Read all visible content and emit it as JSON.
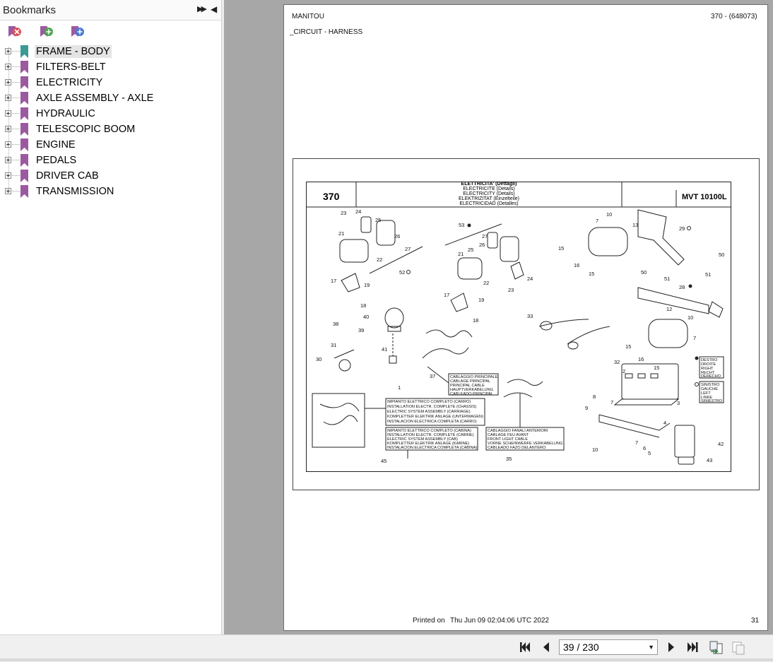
{
  "sidebar": {
    "title": "Bookmarks",
    "toolbar": {
      "delete_icon": "delete-bookmark-icon",
      "add_icon": "add-bookmark-icon",
      "add_child_icon": "add-child-bookmark-icon"
    },
    "items": [
      {
        "label": "FRAME - BODY",
        "selected": true
      },
      {
        "label": "FILTERS-BELT"
      },
      {
        "label": "ELECTRICITY"
      },
      {
        "label": "AXLE ASSEMBLY - AXLE"
      },
      {
        "label": "HYDRAULIC"
      },
      {
        "label": "TELESCOPIC BOOM"
      },
      {
        "label": "ENGINE"
      },
      {
        "label": "PEDALS"
      },
      {
        "label": "DRIVER CAB"
      },
      {
        "label": "TRANSMISSION"
      }
    ]
  },
  "document": {
    "brand": "MANITOU",
    "ref": "370 - (648073)",
    "section": "_CIRCUIT - HARNESS",
    "printed_label": "Printed on",
    "printed_date": "Thu Jun 09 02:04:06 UTC 2022",
    "page_number": "31",
    "figure": {
      "code": "370",
      "model": "MVT 10100L",
      "titles": [
        "ELETTRICITA' (Dettagli)",
        "ELECTRICITE (Details)",
        "ELECTRICITY (Details)",
        "ELEKTRIZITAT (Einzelteile)",
        "ELECTRICIDAD (Detalles)"
      ],
      "callouts": {
        "c37": [
          "CABLAGGIO PRINCIPALE",
          "CABLAGE PRINCIPAL",
          "PRINCIPAL CABLE",
          "HAUPTVERKABELUNG",
          "CABLEADO PRINCIPAL"
        ],
        "c1": [
          "IMPIANTO ELETTRICO COMPLETO (CARRO)",
          "INSTALLATION ELECTR. COMPLETE (CHASSIS)",
          "ELECTRIC SYSTEM ASSEMBLY (CARRIAGE)",
          "KOMPLETTER ELEKTRIK ANLAGE (UNTERWAGEN)",
          "INSTALACION ELECTRICA COMPLETA (CARRO)"
        ],
        "c45": [
          "IMPIANTO ELETTRICO COMPLETO (CABINA)",
          "INSTALLATION ELECTR. COMPLETE (CABINE)",
          "ELECTRIC SYSTEM ASSEMBLY (CAB)",
          "KOMPLETTER ELEKTRIK ANLAGE (KABINE)",
          "INSTALACION ELECTRICA COMPLETA (CABINA)"
        ],
        "c35": [
          "CABLAGGIO FANALI ANTERIORI",
          "CABLAGE FEU AVANT",
          "FRONT LIGHT CABLE",
          "VORNE SCHEINWERFE VERKABELUNG",
          "CABLEADO FAZO DELANTERO"
        ],
        "right": [
          "DESTRO",
          "DROITE",
          "RIGHT",
          "RECHT",
          "DERECHO"
        ],
        "left": [
          "SINISTRO",
          "GAUCHE",
          "LEFT",
          "LINKE",
          "SINIESTRO"
        ]
      },
      "numbers": [
        "23",
        "24",
        "25",
        "21",
        "26",
        "27",
        "22",
        "52",
        "17",
        "19",
        "18",
        "40",
        "38",
        "39",
        "31",
        "41",
        "30",
        "53",
        "27",
        "26",
        "25",
        "21",
        "22",
        "23",
        "24",
        "17",
        "19",
        "18",
        "33",
        "37",
        "1",
        "45",
        "35",
        "10",
        "7",
        "13",
        "15",
        "16",
        "15",
        "29",
        "50",
        "51",
        "50",
        "51",
        "28",
        "12",
        "10",
        "7",
        "15",
        "16",
        "15",
        "32",
        "2",
        "8",
        "7",
        "9",
        "3",
        "4",
        "7",
        "6",
        "5",
        "10",
        "42",
        "43"
      ]
    }
  },
  "statusbar": {
    "page_display": "39 / 230",
    "first_icon": "first-page-icon",
    "prev_icon": "previous-page-icon",
    "next_icon": "next-page-icon",
    "last_icon": "last-page-icon",
    "back_icon": "go-back-icon",
    "forward_icon": "go-forward-icon"
  }
}
